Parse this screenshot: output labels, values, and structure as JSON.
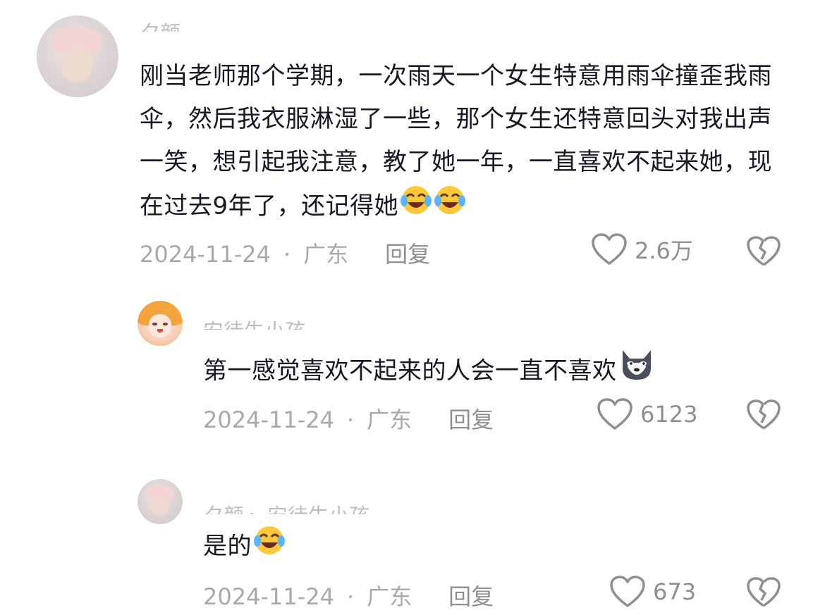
{
  "comments": [
    {
      "username": "夕颜",
      "text": "刚当老师那个学期，一次雨天一个女生特意用雨伞撞歪我雨伞，然后我衣服淋湿了一些，那个女生还特意回头对我出声一笑，想引起我注意，教了她一年，一直喜欢不起来她，现在过去9年了，还记得她",
      "emojis": [
        "laugh-cry-emoji",
        "laugh-cry-emoji"
      ],
      "date": "2024-11-24",
      "dot": "·",
      "location": "广东",
      "reply_label": "回复",
      "likes": "2.6万"
    },
    {
      "username": "安徒生小孩",
      "text": "第一感觉喜欢不起来的人会一直不喜欢",
      "emojis": [
        "doge-emoji"
      ],
      "date": "2024-11-24",
      "dot": "·",
      "location": "广东",
      "reply_label": "回复",
      "likes": "6123"
    },
    {
      "username": "夕颜 ▸ 安徒生小孩",
      "text": "是的",
      "emojis": [
        "laugh-cry-emoji"
      ],
      "date": "2024-11-24",
      "dot": "·",
      "location": "广东",
      "reply_label": "回复",
      "likes": "673"
    }
  ],
  "colors": {
    "text": "#161823",
    "meta": "#a9a9ad",
    "icon": "#8e8e93",
    "emoji": "#ffc83a"
  }
}
